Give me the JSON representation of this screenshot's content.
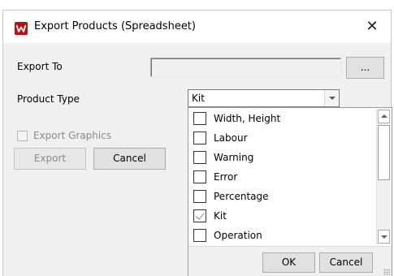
{
  "window": {
    "title": "Export Products (Spreadsheet)",
    "close_glyph": "✕",
    "app_icon": "w-logo-icon",
    "accent_color": "#b7120f"
  },
  "form": {
    "export_to_label": "Export To",
    "export_to_value": "",
    "browse_label": "...",
    "product_type_label": "Product Type",
    "product_type_value": "Kit",
    "export_graphics_label": "Export Graphics",
    "export_graphics_checked": false,
    "export_button": "Export",
    "cancel_button": "Cancel"
  },
  "dropdown": {
    "items": [
      {
        "label": "Width, Height",
        "checked": false
      },
      {
        "label": "Labour",
        "checked": false
      },
      {
        "label": "Warning",
        "checked": false
      },
      {
        "label": "Error",
        "checked": false
      },
      {
        "label": "Percentage",
        "checked": false
      },
      {
        "label": "Kit",
        "checked": true
      },
      {
        "label": "Operation",
        "checked": false
      }
    ],
    "ok_button": "OK",
    "cancel_button": "Cancel"
  }
}
